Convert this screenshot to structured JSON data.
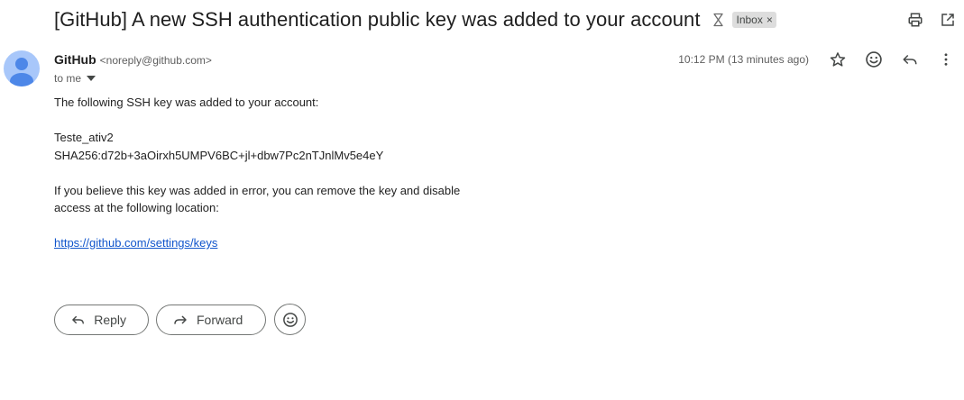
{
  "header": {
    "subject": "[GitHub] A new SSH authentication public key was added to your account",
    "label": "Inbox",
    "label_remove": "×",
    "icons": [
      "importance-marker-icon",
      "print-icon",
      "open-in-new-window-icon"
    ]
  },
  "message": {
    "sender_name": "GitHub",
    "sender_email": "<noreply@github.com>",
    "to": "to me",
    "timestamp": "10:12 PM (13 minutes ago)",
    "meta_icons": [
      "star-icon",
      "emoji-icon",
      "reply-icon",
      "more-vert-icon"
    ],
    "body": {
      "line1": "The following SSH key was added to your account:",
      "key_name": "Teste_ativ2",
      "fingerprint": "SHA256:d72b+3aOirxh5UMPV6BC+jl+dbw7Pc2nTJnlMv5e4eY",
      "error_line1": "If you believe this key was added in error, you can remove the key and disable",
      "error_line2": "access at the following location:",
      "link": "https://github.com/settings/keys"
    }
  },
  "actions": {
    "reply": "Reply",
    "forward": "Forward"
  },
  "colors": {
    "avatar_bg": "#a8c7fa",
    "avatar_fg": "#4d87e8",
    "link": "#1155cc"
  }
}
